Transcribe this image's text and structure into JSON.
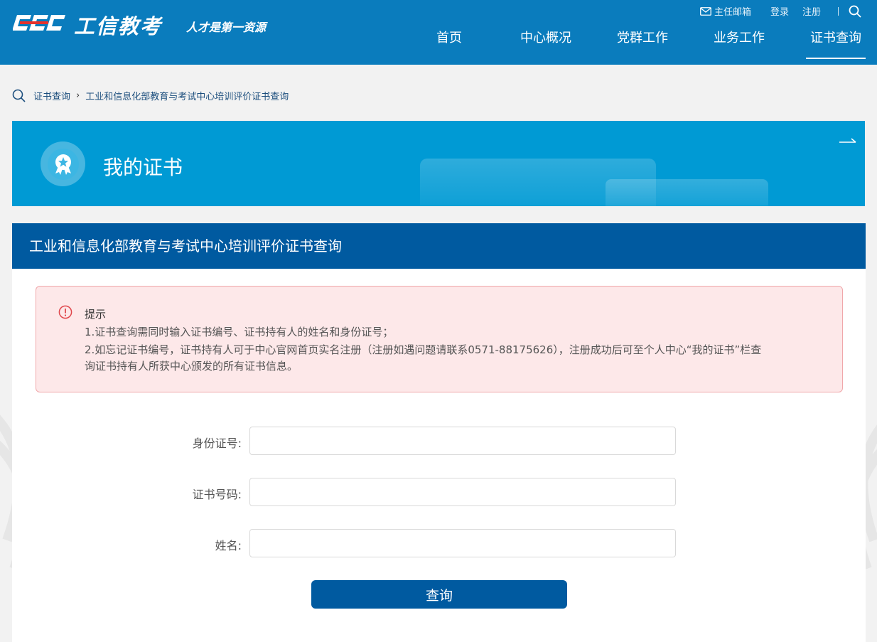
{
  "header": {
    "logo_text": "工信教考",
    "slogan": "人才是第一资源",
    "top_links": {
      "mail": "主任邮箱",
      "login": "登录",
      "register": "注册"
    },
    "nav": [
      {
        "label": "首页"
      },
      {
        "label": "中心概况"
      },
      {
        "label": "党群工作"
      },
      {
        "label": "业务工作"
      },
      {
        "label": "证书查询",
        "active": true
      }
    ]
  },
  "breadcrumb": {
    "items": [
      "证书查询",
      "工业和信息化部教育与考试中心培训评价证书查询"
    ]
  },
  "banner": {
    "title": "我的证书"
  },
  "panel": {
    "title": "工业和信息化部教育与考试中心培训评价证书查询",
    "notice": {
      "title": "提示",
      "line1": "1.证书查询需同时输入证书编号、证书持有人的姓名和身份证号；",
      "line2": "2.如忘记证书编号，证书持有人可于中心官网首页实名注册（注册如遇问题请联系0571-88175626），注册成功后可至个人中心“我的证书”栏查",
      "line3": "询证书持有人所获中心颁发的所有证书信息。"
    },
    "form": {
      "id_label": "身份证号:",
      "id_value": "",
      "cert_label": "证书号码:",
      "cert_value": "",
      "name_label": "姓名:",
      "name_value": "",
      "submit_label": "查询"
    }
  },
  "colors": {
    "header_bg": "#0a7cbd",
    "banner_bg": "#009ad4",
    "panel_head_bg": "#005aa0",
    "notice_bg": "#fde8e9",
    "notice_border": "#f0a7aa",
    "button_bg": "#005aa0"
  }
}
